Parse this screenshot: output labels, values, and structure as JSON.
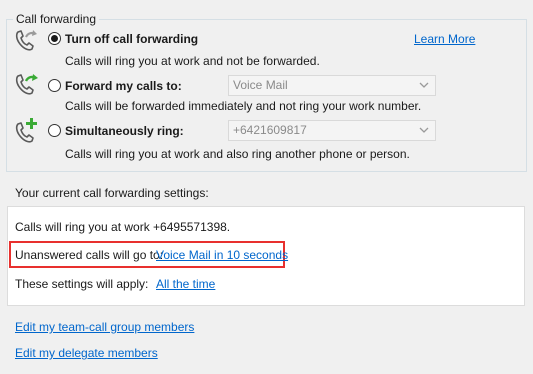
{
  "group": {
    "title": "Call forwarding",
    "learn_more": "Learn More",
    "options": [
      {
        "label": "Turn off call forwarding",
        "selected": true,
        "description": "Calls will ring you at work and not be forwarded.",
        "icon": "phone-forward-arrow-icon"
      },
      {
        "label": "Forward my calls to:",
        "selected": false,
        "select_value": "Voice Mail",
        "description": "Calls will be forwarded immediately and not ring your work number.",
        "icon": "phone-forward-green-arrow-icon"
      },
      {
        "label": "Simultaneously ring:",
        "selected": false,
        "select_value": "+6421609817",
        "description": "Calls will ring you at work and also ring another phone or person.",
        "icon": "phone-plus-icon"
      }
    ]
  },
  "current": {
    "title": "Your current call forwarding settings:",
    "ring_line": "Calls will ring you at work +6495571398.",
    "unanswered_label": "Unanswered calls will go to:",
    "unanswered_link": "Voice Mail in 10 seconds",
    "apply_label": "These settings will apply:",
    "apply_link": "All the time"
  },
  "links": {
    "team_call": "Edit my team-call group members",
    "delegate": "Edit my delegate members"
  },
  "colors": {
    "link": "#0066cc",
    "accent_green": "#3aaa35",
    "highlight_border": "#e8302e"
  }
}
